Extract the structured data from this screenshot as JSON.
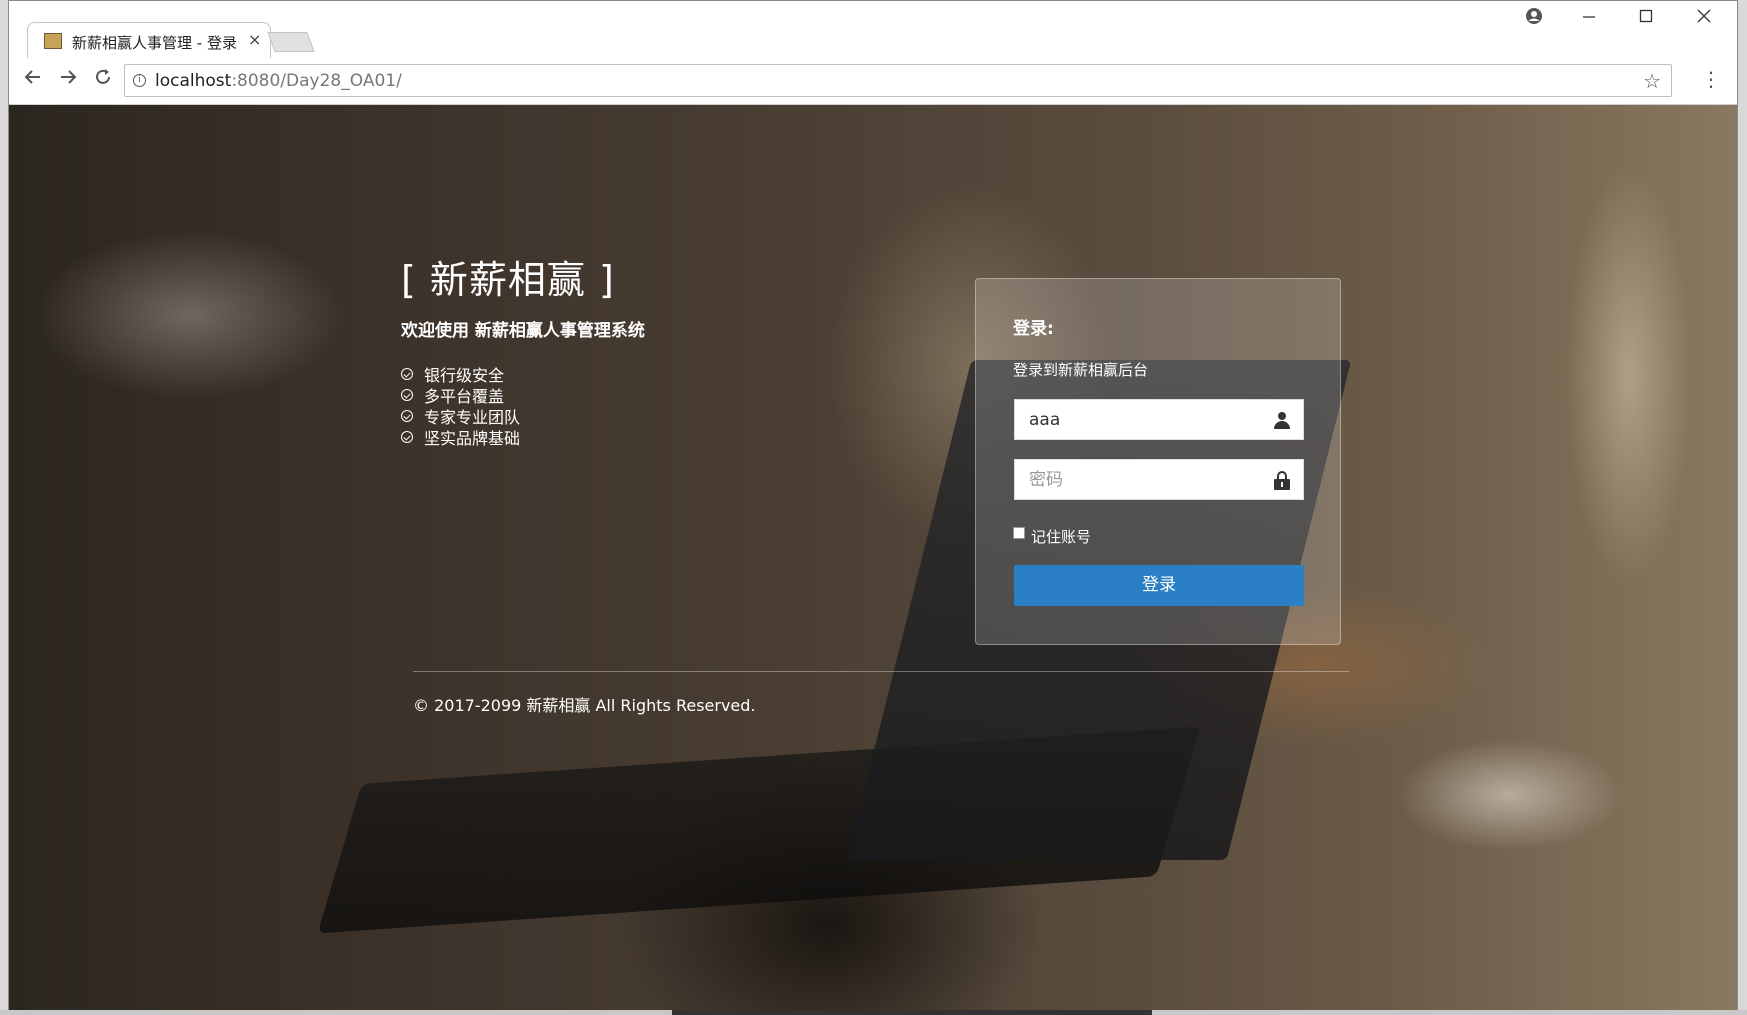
{
  "browser": {
    "tab_title": "新薪相赢人事管理 - 登录",
    "tab_close": "×",
    "url_host": "localhost",
    "url_rest": ":8080/Day28_OA01/"
  },
  "page": {
    "brand": "[ 新薪相赢 ]",
    "welcome": "欢迎使用 新薪相赢人事管理系统",
    "features": [
      "银行级安全",
      "多平台覆盖",
      "专家专业团队",
      "坚实品牌基础"
    ],
    "login": {
      "title": "登录:",
      "subtitle": "登录到新薪相赢后台",
      "username_value": "aaa",
      "password_placeholder": "密码",
      "remember_label": "记住账号",
      "submit_label": "登录"
    },
    "footer": "© 2017-2099 新薪相赢 All Rights Reserved."
  },
  "colors": {
    "login_button": "#2b7fc4"
  },
  "icons": [
    "account-icon",
    "minimize-icon",
    "maximize-icon",
    "close-icon",
    "back-icon",
    "forward-icon",
    "reload-icon",
    "info-icon",
    "star-icon",
    "menu-icon",
    "user-icon",
    "lock-icon",
    "check-circle-icon"
  ]
}
